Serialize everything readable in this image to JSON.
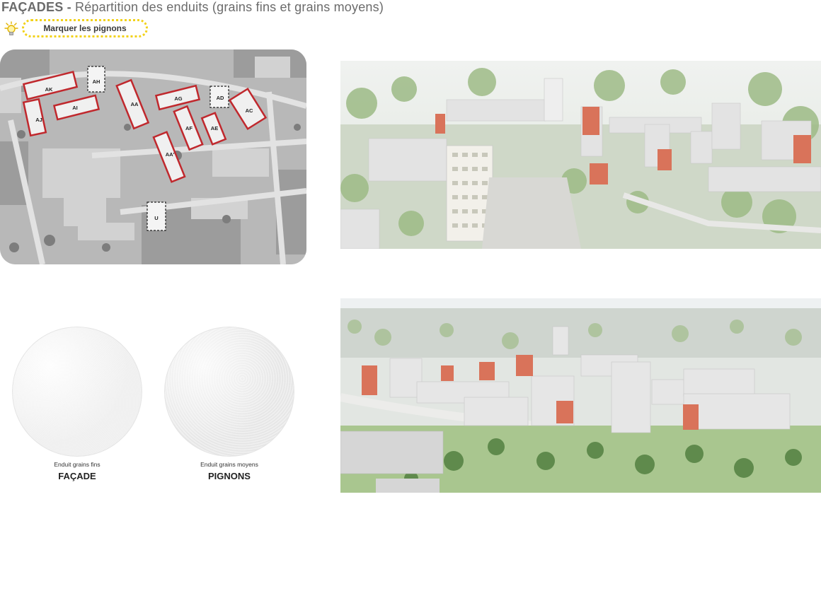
{
  "header": {
    "title_bold": "FAÇADES -",
    "title_rest": " Répartition des enduits (grains fins et grains moyens)"
  },
  "hint": {
    "icon": "lightbulb-icon",
    "label": "Marquer les pignons",
    "color": "#f2d21b"
  },
  "aerial_map": {
    "accent": "#c0282d",
    "buildings": [
      "AK",
      "AH",
      "AJ",
      "AI",
      "AA",
      "AG",
      "AD",
      "AC",
      "AF",
      "AE",
      "AA'",
      "U"
    ]
  },
  "materials": [
    {
      "caption": "Enduit grains fins",
      "label": "FAÇADE"
    },
    {
      "caption": "Enduit grains moyens",
      "label": "PIGNONS"
    }
  ],
  "colors": {
    "pignon": "#d9735a",
    "vegetation": "#7fa86a",
    "building": "#e6e6e6"
  }
}
